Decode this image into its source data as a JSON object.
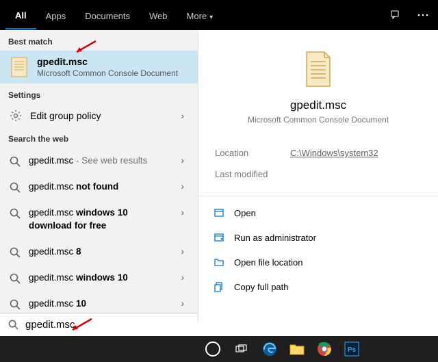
{
  "tabs": {
    "all": "All",
    "apps": "Apps",
    "documents": "Documents",
    "web": "Web",
    "more": "More"
  },
  "left": {
    "best_match_hdr": "Best match",
    "best": {
      "title": "gpedit.msc",
      "subtitle": "Microsoft Common Console Document"
    },
    "settings_hdr": "Settings",
    "settings_item": "Edit group policy",
    "web_hdr": "Search the web",
    "web_items": [
      {
        "prefix": "gpedit.msc",
        "sub": " - See web results",
        "bold": ""
      },
      {
        "prefix": "gpedit.msc ",
        "sub": "",
        "bold": "not found"
      },
      {
        "prefix": "gpedit.msc ",
        "sub": "",
        "bold": "windows 10 download for free"
      },
      {
        "prefix": "gpedit.msc ",
        "sub": "",
        "bold": "8"
      },
      {
        "prefix": "gpedit.msc ",
        "sub": "",
        "bold": "windows 10"
      },
      {
        "prefix": "gpedit.msc ",
        "sub": "",
        "bold": "10"
      }
    ]
  },
  "preview": {
    "title": "gpedit.msc",
    "subtitle": "Microsoft Common Console Document",
    "location_label": "Location",
    "location_value": "C:\\Windows\\system32",
    "modified_label": "Last modified",
    "actions": {
      "open": "Open",
      "run_admin": "Run as administrator",
      "open_loc": "Open file location",
      "copy_path": "Copy full path"
    }
  },
  "search": {
    "value": "gpedit.msc"
  }
}
